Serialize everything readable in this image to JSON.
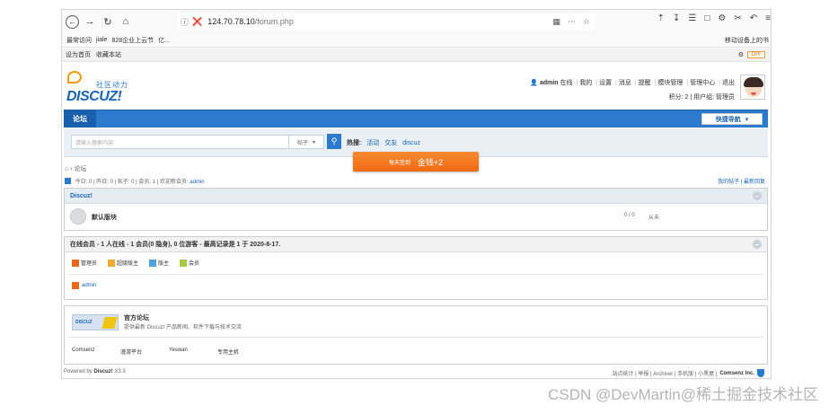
{
  "browser": {
    "url_host": "124.70.78.10",
    "url_path": "/forum.php",
    "bookmarks": [
      "最常访问",
      "jiale",
      "828企业上云节",
      "亿..."
    ],
    "mobile_bookmarks": "移动设备上的书"
  },
  "topbar": {
    "left": [
      "设为首页",
      "收藏本站"
    ],
    "diy": "DIY"
  },
  "logo": {
    "slogan": "社区动力",
    "word": "DISCUZ!"
  },
  "user": {
    "name": "admin",
    "status": "在线",
    "links": [
      "我的",
      "设置",
      "消息",
      "提醒",
      "模块管理",
      "管理中心",
      "退出"
    ],
    "credits_label": "积分: 2",
    "group_label": "用户组: 管理员"
  },
  "nav": {
    "tab": "论坛",
    "quick": "快捷导航"
  },
  "search": {
    "placeholder": "请输入搜索内容",
    "type": "帖子",
    "hot_label": "热搜:",
    "hot_items": [
      "活动",
      "交友",
      "discuz"
    ]
  },
  "task_banner": {
    "label": "每天签到",
    "reward": "金钱+2"
  },
  "breadcrumb": "论坛",
  "stats": {
    "text": "今日: 0 | 昨日: 0 | 帖子: 0 | 会员: 1 | 欢迎新会员: ",
    "new_member": "admin",
    "right": [
      "我的帖子",
      "最新回复"
    ]
  },
  "forum_group": {
    "title": "Discuz!",
    "forum_name": "默认版块",
    "count": "0 / 0",
    "last": "从未"
  },
  "online": {
    "title": "在线会员 - 1 人在线 - 1 会员(0 隐身), 0 位游客 - 最高记录是 1 于 2020-8-17.",
    "legend": [
      {
        "label": "管理员",
        "color": "#e8671b"
      },
      {
        "label": "超级版主",
        "color": "#f0a830"
      },
      {
        "label": "版主",
        "color": "#4aa3df"
      },
      {
        "label": "会员",
        "color": "#a7c941"
      }
    ],
    "user": "admin",
    "user_color": "#e8671b"
  },
  "links": {
    "title": "官方论坛",
    "desc": "提供最新 Discuz! 产品新闻、软件下载与技术交流",
    "partners": [
      "Comsenz",
      "漫游平台",
      "Yeswan",
      "专用主机"
    ]
  },
  "footer": {
    "powered": "Powered by ",
    "brand": "Discuz!",
    "version": " X3.3",
    "right": "站点统计 | 举报 | Archiver | 手机版 | 小黑屋 | ",
    "company": "Comsenz Inc."
  },
  "watermark": "CSDN @DevMartin@稀土掘金技术社区",
  "colors": {
    "accent": "#2b7acd",
    "task": "#f27a22"
  }
}
